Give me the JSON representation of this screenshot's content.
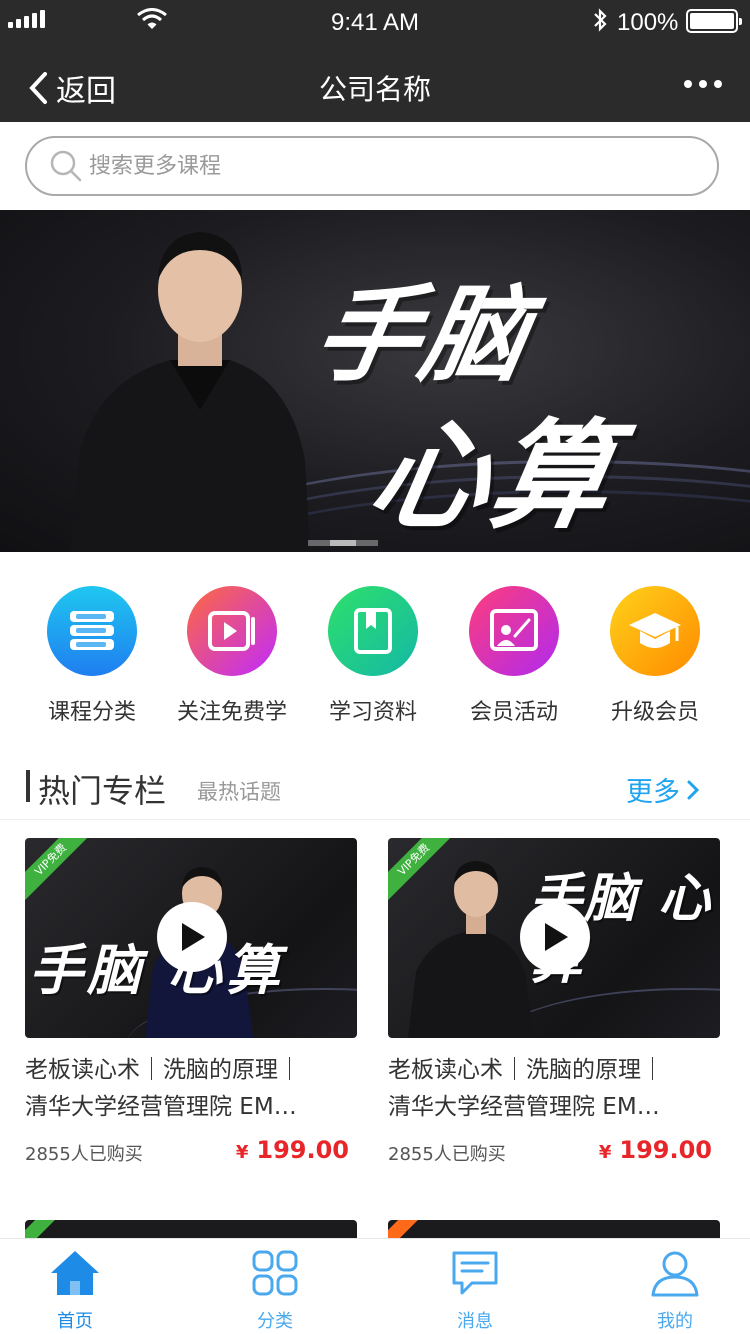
{
  "status_bar": {
    "time": "9:41 AM",
    "battery": "100%"
  },
  "nav": {
    "back_label": "返回",
    "title": "公司名称"
  },
  "search": {
    "placeholder": "搜索更多课程"
  },
  "banner": {
    "line1": "手脑",
    "line2": "心算",
    "slide_count": 3,
    "active_slide": 2
  },
  "menu": [
    {
      "label": "课程分类",
      "icon": "books-stack-icon",
      "color_from": "#1fc7f0",
      "color_to": "#1f7ef0"
    },
    {
      "label": "关注免费学",
      "icon": "video-play-icon",
      "color_from": "#ff6a3d",
      "color_to": "#c02aff"
    },
    {
      "label": "学习资料",
      "icon": "bookmark-book-icon",
      "color_from": "#2ee06a",
      "color_to": "#14b8a6"
    },
    {
      "label": "会员活动",
      "icon": "presenter-board-icon",
      "color_from": "#ff3d7a",
      "color_to": "#b02af0"
    },
    {
      "label": "升级会员",
      "icon": "graduation-cap-icon",
      "color_from": "#ffd21a",
      "color_to": "#ff8a00"
    }
  ],
  "section": {
    "title": "热门专栏",
    "subtitle": "最热话题",
    "more_label": "更多"
  },
  "cards": [
    {
      "badge": "VIP免费",
      "thumb_text": "手脑 心算",
      "title_line1": "老板读心术｜洗脑的原理｜",
      "title_line2": "清华大学经营管理院 EM…",
      "buyers": "2855人已购买",
      "currency": "¥",
      "price": "199.00"
    },
    {
      "badge": "VIP免费",
      "thumb_text": "手脑 心算",
      "title_line1": "老板读心术｜洗脑的原理｜",
      "title_line2": "清华大学经营管理院 EM…",
      "buyers": "2855人已购买",
      "currency": "¥",
      "price": "199.00"
    }
  ],
  "colors": {
    "header_bg": "#2b2b2b",
    "accent_blue": "#21a4f0",
    "price_red": "#e8262a",
    "vip_green": "#3eb13f"
  },
  "tabs": [
    {
      "label": "首页",
      "icon": "home-icon",
      "active": true
    },
    {
      "label": "分类",
      "icon": "grid-icon",
      "active": false
    },
    {
      "label": "消息",
      "icon": "message-icon",
      "active": false
    },
    {
      "label": "我的",
      "icon": "user-icon",
      "active": false
    }
  ]
}
